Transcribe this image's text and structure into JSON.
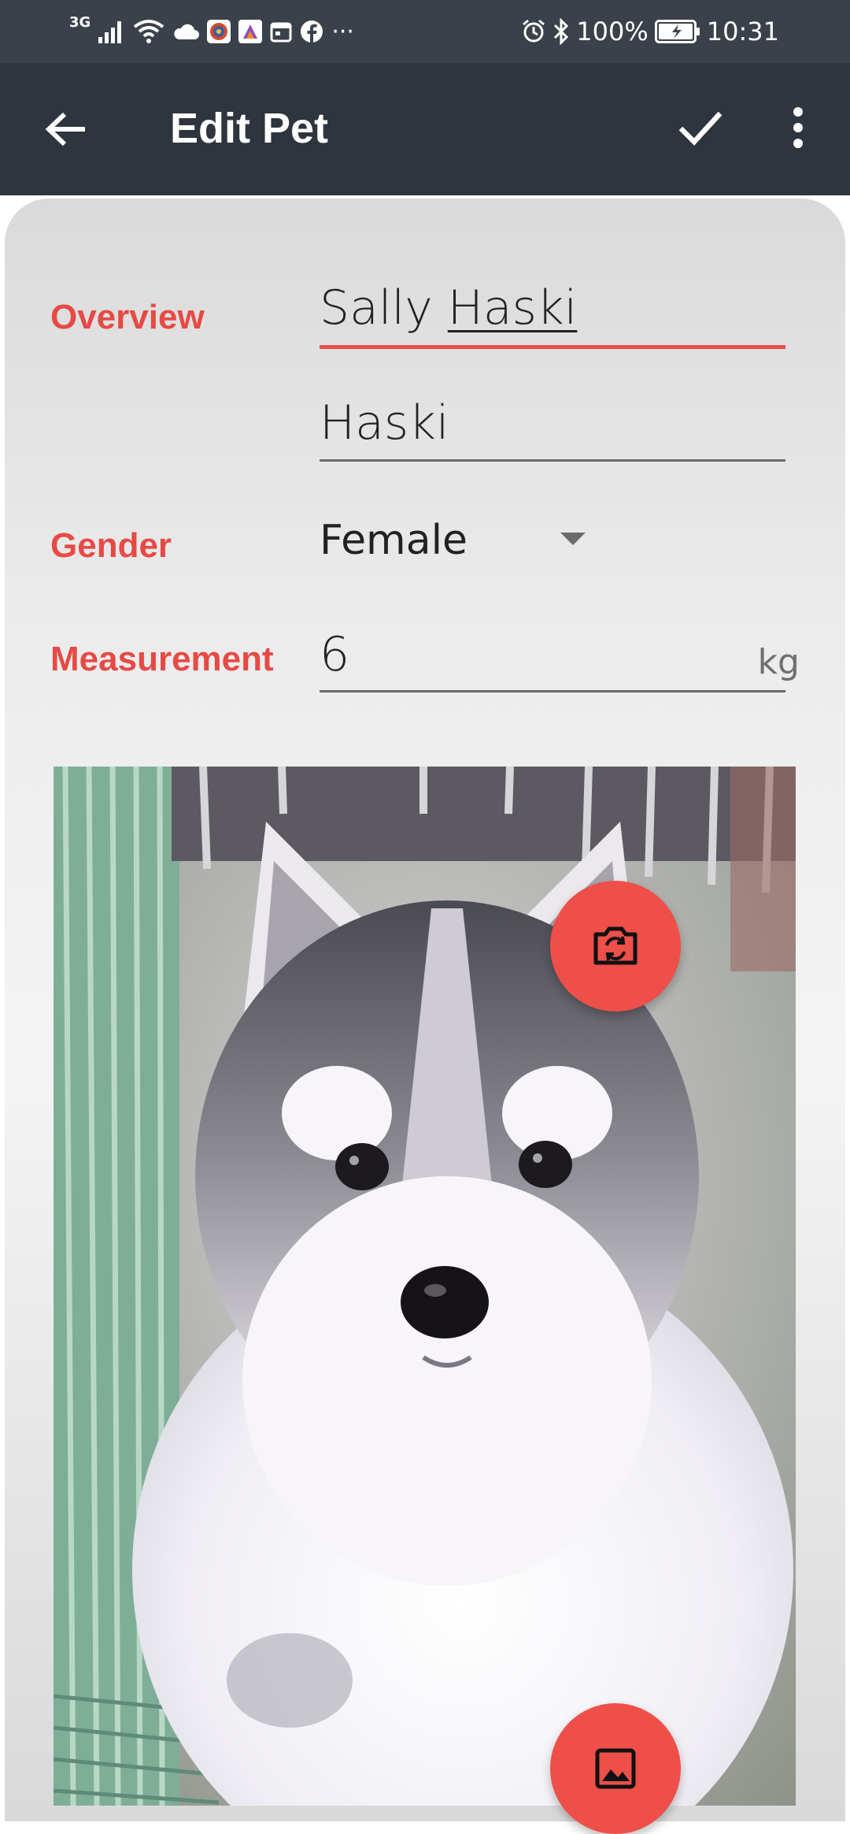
{
  "status_bar": {
    "network": "3G",
    "battery": "100%",
    "time": "10:31",
    "more_glyph": "···"
  },
  "app_bar": {
    "title": "Edit Pet"
  },
  "form": {
    "overview_label": "Overview",
    "name_first": "Sally ",
    "name_last": "Haski",
    "breed_value": "Haski",
    "gender_label": "Gender",
    "gender_value": "Female",
    "measurement_label": "Measurement",
    "measurement_value": "6",
    "measurement_unit": "kg"
  },
  "colors": {
    "accent": "#e64a45",
    "status_bar": "#3a414a",
    "app_bar": "#2f353e",
    "fab": "#ee4f49"
  },
  "icons": {
    "back": "arrow-back-icon",
    "save": "check-icon",
    "menu": "more-vert-icon",
    "camera": "switch-camera-icon",
    "gallery": "image-icon"
  }
}
